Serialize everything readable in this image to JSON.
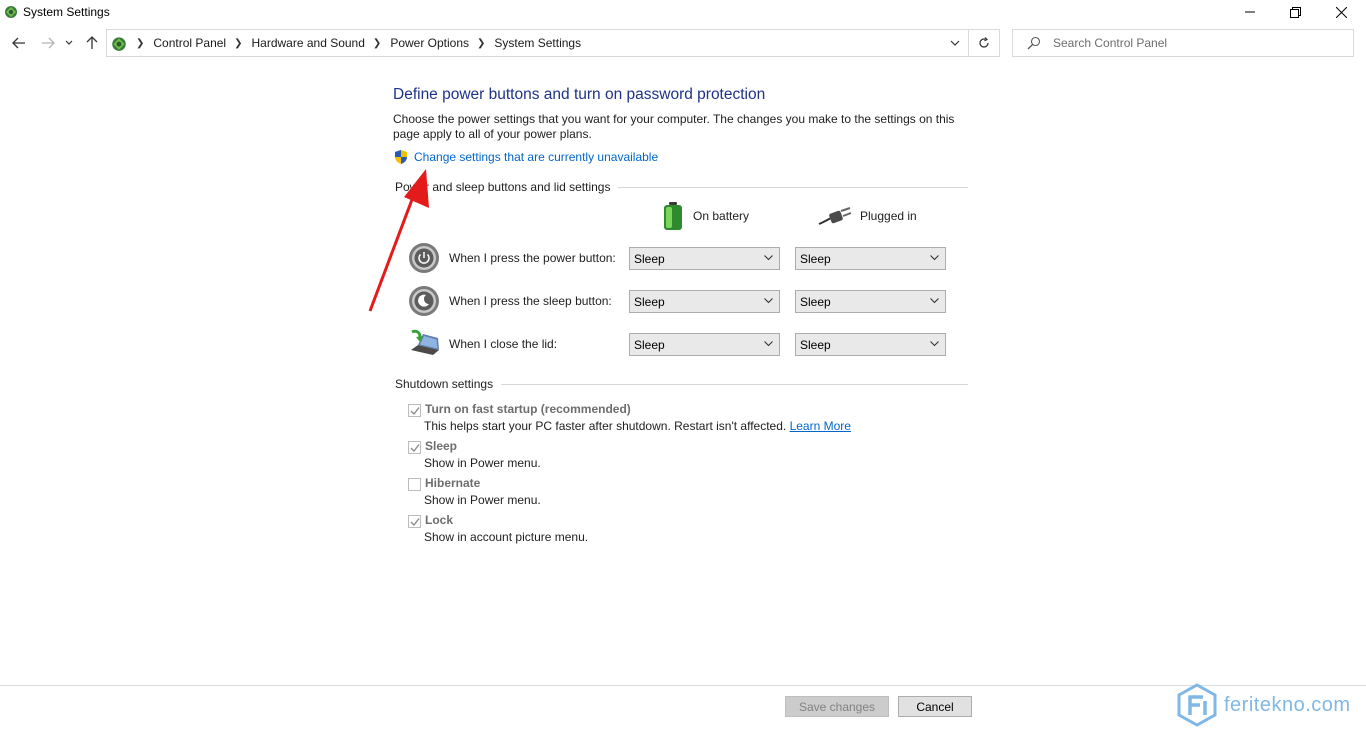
{
  "window": {
    "title": "System Settings"
  },
  "breadcrumb": [
    "Control Panel",
    "Hardware and Sound",
    "Power Options",
    "System Settings"
  ],
  "search": {
    "placeholder": "Search Control Panel"
  },
  "page": {
    "title": "Define power buttons and turn on password protection",
    "description": "Choose the power settings that you want for your computer. The changes you make to the settings on this page apply to all of your power plans.",
    "change_link": "Change settings that are currently unavailable"
  },
  "buttons_section": {
    "label": "Power and sleep buttons and lid settings",
    "columns": {
      "battery": "On battery",
      "plugged": "Plugged in"
    },
    "rows": [
      {
        "label": "When I press the power button:",
        "battery": "Sleep",
        "plugged": "Sleep",
        "icon": "power-button-icon"
      },
      {
        "label": "When I press the sleep button:",
        "battery": "Sleep",
        "plugged": "Sleep",
        "icon": "sleep-button-icon"
      },
      {
        "label": "When I close the lid:",
        "battery": "Sleep",
        "plugged": "Sleep",
        "icon": "laptop-lid-icon"
      }
    ]
  },
  "shutdown_section": {
    "label": "Shutdown settings",
    "items": [
      {
        "label": "Turn on fast startup (recommended)",
        "desc": "This helps start your PC faster after shutdown. Restart isn't affected.",
        "link": "Learn More",
        "checked": true
      },
      {
        "label": "Sleep",
        "desc": "Show in Power menu.",
        "checked": true
      },
      {
        "label": "Hibernate",
        "desc": "Show in Power menu.",
        "checked": false
      },
      {
        "label": "Lock",
        "desc": "Show in account picture menu.",
        "checked": true
      }
    ]
  },
  "footer": {
    "save": "Save changes",
    "cancel": "Cancel"
  },
  "watermark": {
    "text": "feritekno.com"
  },
  "colors": {
    "title": "#1e3287",
    "link": "#0066cc",
    "arrow": "#e31b1b",
    "watermark": "#7fb8e6"
  }
}
